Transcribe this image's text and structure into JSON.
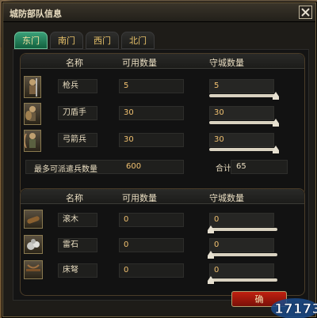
{
  "window": {
    "title": "城防部队信息"
  },
  "tabs": [
    {
      "label": "东门",
      "active": true
    },
    {
      "label": "南门",
      "active": false
    },
    {
      "label": "西门",
      "active": false
    },
    {
      "label": "北门",
      "active": false
    }
  ],
  "headers": {
    "name": "名称",
    "available": "可用数量",
    "garrison": "守城数量"
  },
  "troops": [
    {
      "name": "枪兵",
      "available": "5",
      "garrison": "5",
      "fill": 1.0,
      "icon": "spearman-portrait"
    },
    {
      "name": "刀盾手",
      "available": "30",
      "garrison": "30",
      "fill": 1.0,
      "icon": "swordshield-portrait"
    },
    {
      "name": "弓箭兵",
      "available": "30",
      "garrison": "30",
      "fill": 1.0,
      "icon": "archer-portrait"
    }
  ],
  "summary": {
    "max_label": "最多可派遣兵数量",
    "max_value": "600",
    "total_label": "合计",
    "total_value": "65"
  },
  "equipment": [
    {
      "name": "滚木",
      "available": "0",
      "garrison": "0",
      "fill": 0.0,
      "icon": "log-icon"
    },
    {
      "name": "雷石",
      "available": "0",
      "garrison": "0",
      "fill": 0.0,
      "icon": "stone-icon"
    },
    {
      "name": "床弩",
      "available": "0",
      "garrison": "0",
      "fill": 0.0,
      "icon": "ballista-icon"
    }
  ],
  "buttons": {
    "confirm": "确"
  },
  "watermark": "17173"
}
